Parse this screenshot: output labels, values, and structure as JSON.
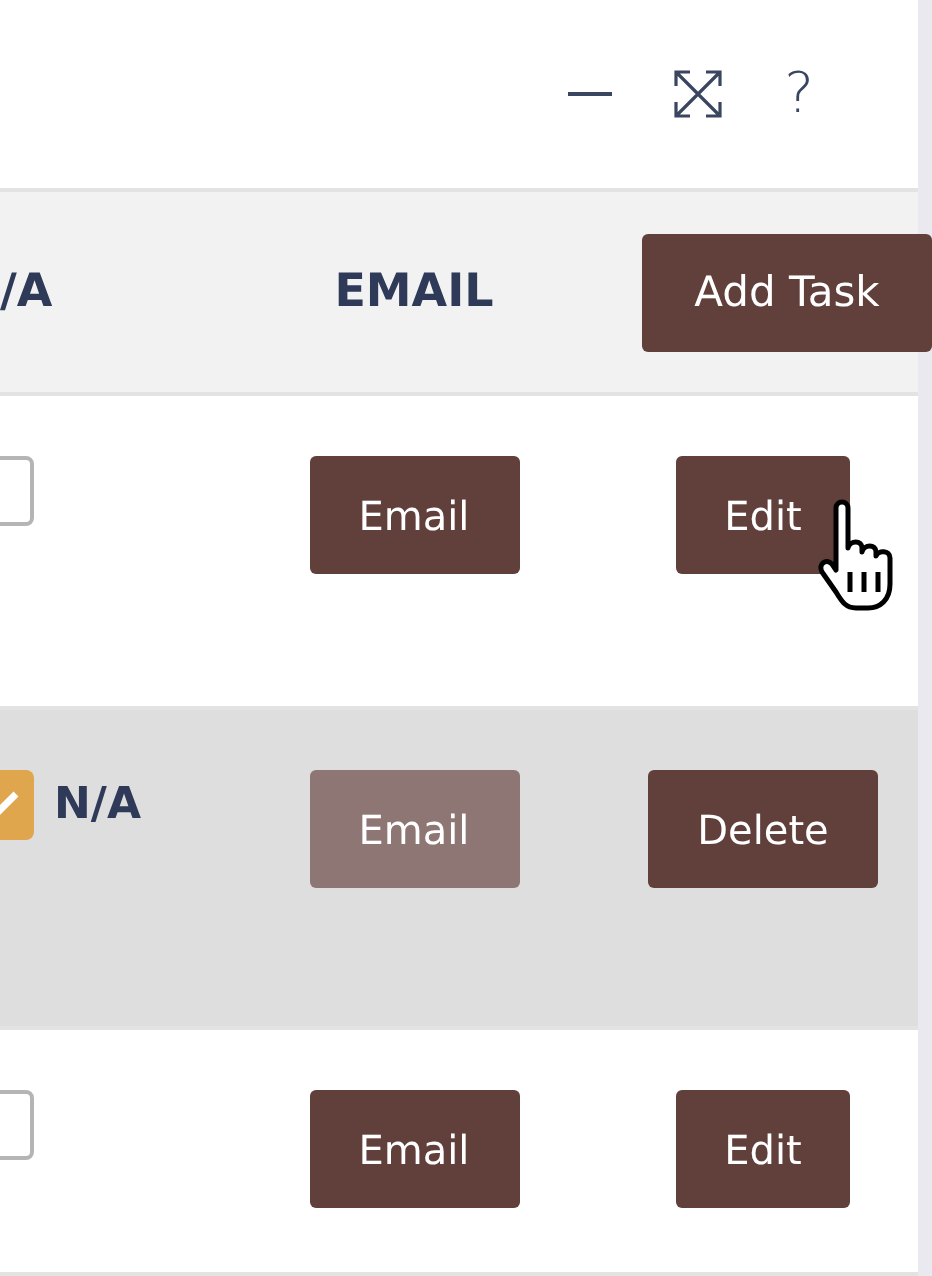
{
  "toolbar": {
    "help_label": "?"
  },
  "table": {
    "columns": [
      {
        "label": "/A"
      },
      {
        "label": "EMAIL"
      }
    ],
    "add_button": "Add Task",
    "rows": [
      {
        "selected": false,
        "na_checked": false,
        "email": {
          "label": "Email",
          "disabled": false
        },
        "action": "Edit",
        "hovered": true
      },
      {
        "selected": true,
        "na_checked": true,
        "na_label": "N/A",
        "email": {
          "label": "Email",
          "disabled": true
        },
        "action": "Delete",
        "hovered": false
      },
      {
        "selected": false,
        "na_checked": false,
        "email": {
          "label": "Email",
          "disabled": false
        },
        "action": "Edit",
        "hovered": false
      }
    ]
  }
}
